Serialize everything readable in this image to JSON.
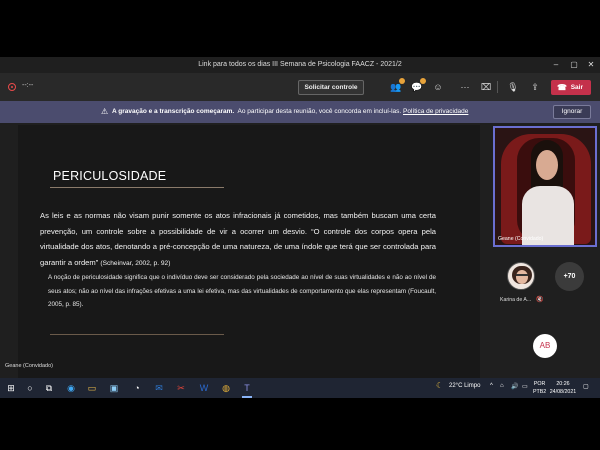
{
  "window": {
    "title": "Link para todos os dias III Semana de Psicologia FAACZ - 2021/2"
  },
  "toolbar": {
    "timer": "--:--",
    "request_control_label": "Solicitar controle",
    "leave_label": "Sair"
  },
  "banner": {
    "bold_text": "A gravação e a transcrição começaram.",
    "text": "Ao participar desta reunião, você concorda em incluí-las.",
    "link_text": "Política de privacidade",
    "ignore_label": "Ignorar"
  },
  "slide": {
    "title": "PERICULOSIDADE",
    "paragraph": "As leis e as normas não visam punir somente os atos infracionais já cometidos, mas também buscam uma certa prevenção, um controle sobre a possibilidade de vir a ocorrer um desvio. “O controle dos corpos opera pela virtualidade dos atos, denotando a pré-concepção de uma natureza, de uma índole que terá que ser controlada para garantir a ordem”",
    "paragraph_ref": "(Scheinvar, 2002, p. 92)",
    "quote": "A noção de periculosidade significa que o indivíduo deve ser considerado pela sociedade ao nível de suas virtualidades e não ao nível de seus atos; não ao nível das infrações efetivas a uma lei efetiva, mas das virtualidades de comportamento que elas representam (Foucault, 2005, p. 85).",
    "presenter": "Geane (Convidado)"
  },
  "participants": {
    "main_video_name": "Geane (Convidado)",
    "second_name": "Karina de A...",
    "more_count": "+70",
    "initials": "AB"
  },
  "taskbar": {
    "weather": "22°C  Limpo",
    "lang_top": "POR",
    "lang_bottom": "PTB2",
    "time": "20:26",
    "date": "24/08/2021"
  },
  "icons": {
    "start": "windows-icon",
    "search": "search-icon",
    "taskview": "task-view-icon"
  }
}
